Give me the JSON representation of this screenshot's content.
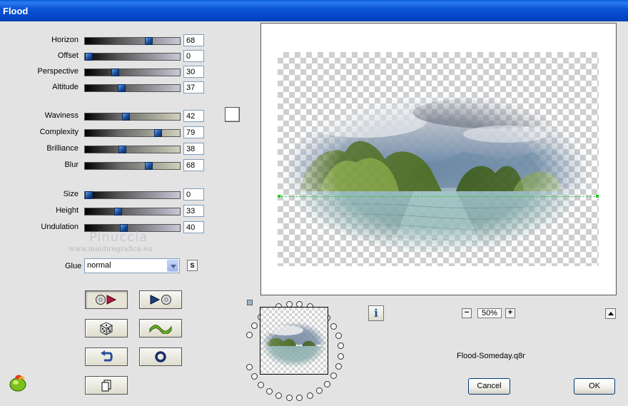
{
  "window": {
    "title": "Flood"
  },
  "groups": [
    {
      "params": [
        {
          "label": "Horizon",
          "value": "68",
          "level": 68
        },
        {
          "label": "Offset",
          "value": "0",
          "level": 0
        },
        {
          "label": "Perspective",
          "value": "30",
          "level": 30
        },
        {
          "label": "Altitude",
          "value": "37",
          "level": 37
        }
      ]
    },
    {
      "params": [
        {
          "label": "Waviness",
          "value": "42",
          "level": 42
        },
        {
          "label": "Complexity",
          "value": "79",
          "level": 79
        },
        {
          "label": "Brilliance",
          "value": "38",
          "level": 38
        },
        {
          "label": "Blur",
          "value": "68",
          "level": 68
        }
      ]
    },
    {
      "params": [
        {
          "label": "Size",
          "value": "0",
          "level": 0
        },
        {
          "label": "Height",
          "value": "33",
          "level": 33
        },
        {
          "label": "Undulation",
          "value": "40",
          "level": 40
        }
      ]
    }
  ],
  "glue": {
    "label": "Glue",
    "value": "normal",
    "s_button": "S"
  },
  "watermark": {
    "name": "Pinuccia",
    "url": "www.maidiregrafica.eu"
  },
  "zoom": {
    "value": "50%",
    "minus": "−",
    "plus": "+"
  },
  "info_label": "i",
  "preset_name": "Flood-Someday.q8r",
  "buttons": {
    "cancel": "Cancel",
    "ok": "OK"
  },
  "colors": {
    "titlebar": "#0a5bd8",
    "slider_thumb": "#1b4f9c",
    "horizon_line": "#3ec93e"
  }
}
